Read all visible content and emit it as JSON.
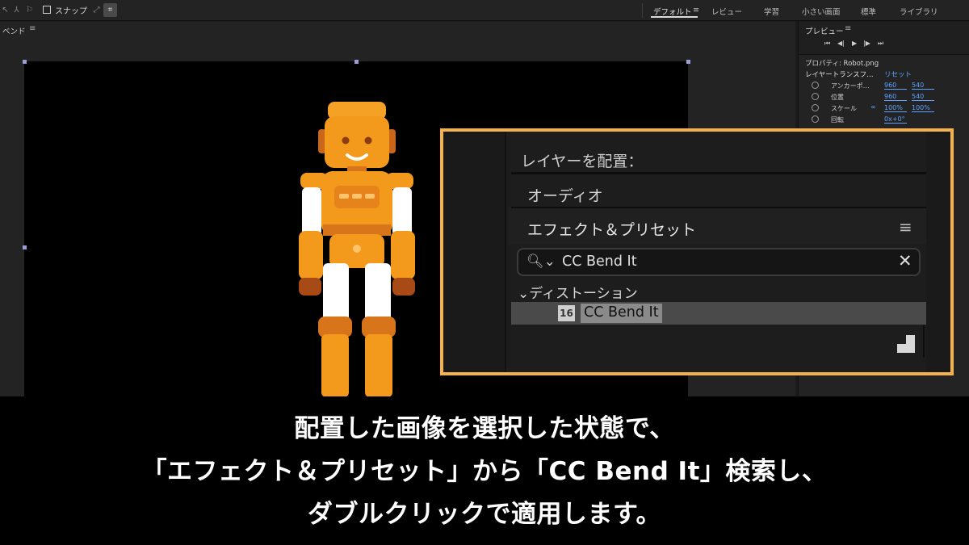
{
  "toolbar": {
    "snap_label": "スナップ",
    "workspaces": [
      "デフォルト",
      "レビュー",
      "学習",
      "小さい画面",
      "標準",
      "ライブラリ"
    ],
    "active_menu_icon": "≡"
  },
  "comp_panel": {
    "title": "ベンド",
    "menu_icon": "≡"
  },
  "preview_panel": {
    "title": "プレビュー",
    "menu_icon": "≡",
    "controls": [
      "⏮",
      "◀|",
      "▶",
      "|▶",
      "⏭"
    ]
  },
  "properties_panel": {
    "title": "プロパティ: Robot.png",
    "section": "レイヤートランスフ…",
    "reset": "リセット",
    "rows": [
      {
        "name": "アンカーポ…",
        "v1": "960",
        "v2": "540"
      },
      {
        "name": "位置",
        "v1": "960",
        "v2": "540"
      },
      {
        "name": "スケール",
        "v1": "100%",
        "v2": "100%"
      },
      {
        "name": "回転",
        "v1": "0x+0°",
        "v2": ""
      }
    ]
  },
  "zoom_panel": {
    "place_layer_title": "レイヤーを配置：",
    "audio_label": "オーディオ",
    "effects_title": "エフェクト＆プリセット",
    "effects_menu_icon": "≡",
    "search_icon": "magnifier-dropdown-icon",
    "search_value": "CC Bend It",
    "clear_icon": "✕",
    "category": "ディストーション",
    "category_chevron": "⌄",
    "effect_badge": "16",
    "effect_name": "CC Bend It"
  },
  "caption": {
    "line1": "配置した画像を選択した状態で、",
    "line2": "「エフェクト＆プリセット」から「CC Bend It」検索し、",
    "line3": "ダブルクリックで適用します。"
  },
  "colors": {
    "callout_border": "#f5b24a",
    "link_blue": "#5ea3ff",
    "robot_orange": "#f39a1d"
  }
}
